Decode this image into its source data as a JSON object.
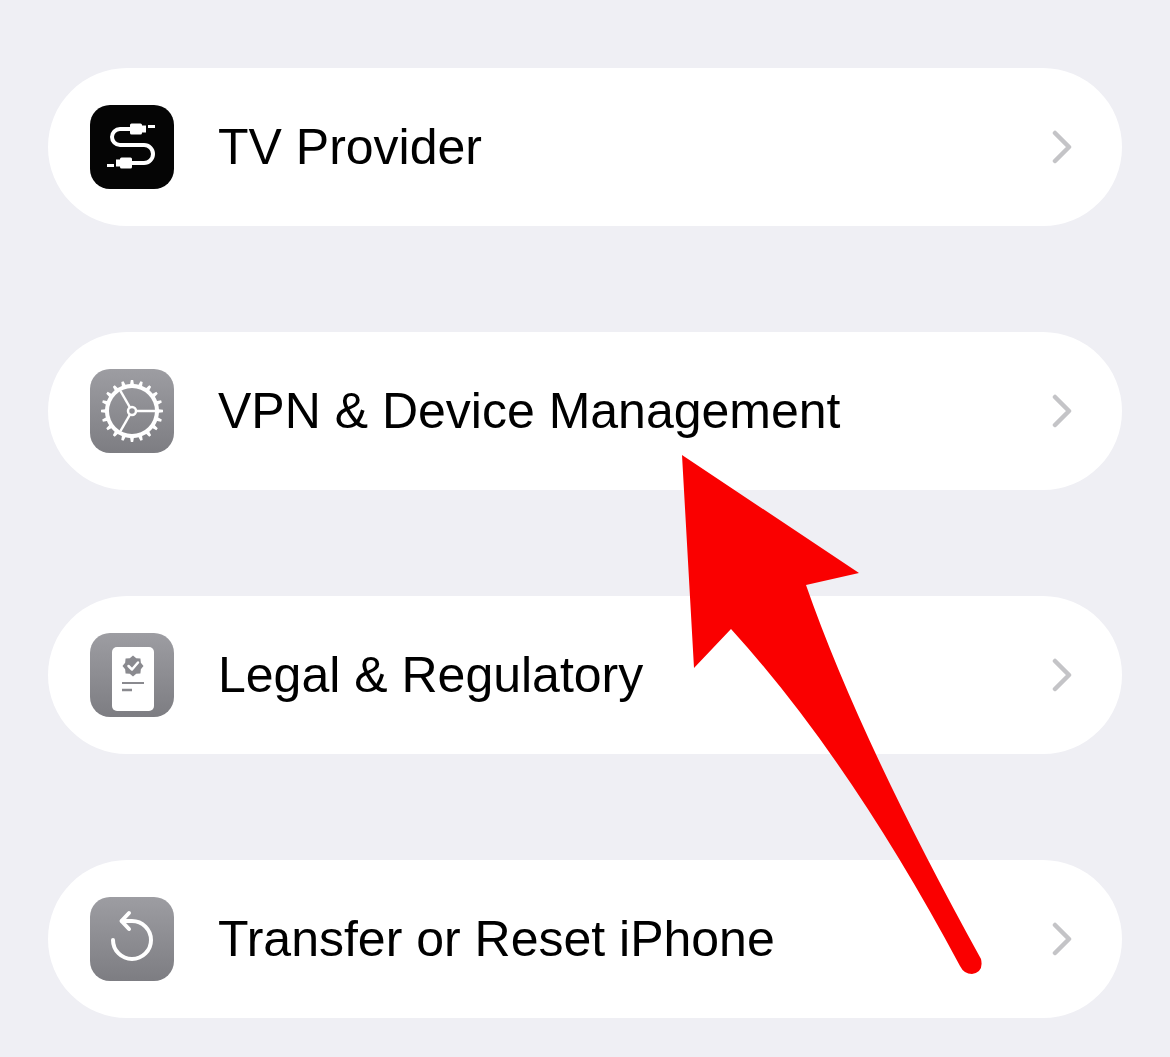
{
  "rows": [
    {
      "label": "TV Provider"
    },
    {
      "label": "VPN & Device Management"
    },
    {
      "label": "Legal & Regulatory"
    },
    {
      "label": "Transfer or Reset iPhone"
    }
  ],
  "annotations": [
    {
      "kind": "arrow"
    }
  ]
}
